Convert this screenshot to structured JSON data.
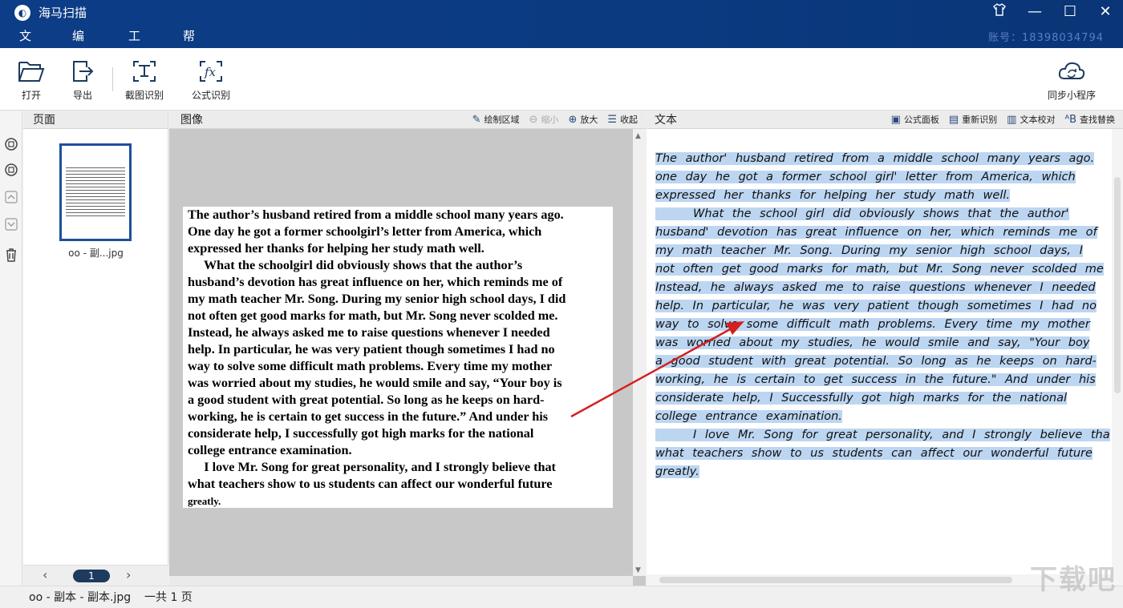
{
  "app": {
    "title": "海马扫描",
    "account": "账号：18398034794"
  },
  "menu": [
    "文件",
    "编辑",
    "工具",
    "帮助"
  ],
  "window": {
    "skin_icon": "shirt-icon",
    "minimize": "—",
    "maximize": "☐",
    "close": "✕"
  },
  "toolbar": {
    "open": "打开",
    "export": "导出",
    "crop_ocr": "截图识别",
    "formula_ocr": "公式识别",
    "sync": "同步小程序"
  },
  "pages": {
    "header": "页面",
    "thumb_name": "oo - 副...jpg",
    "page_number": "1"
  },
  "image": {
    "header": "图像",
    "draw_area": "绘制区域",
    "zoom_out": "缩小",
    "zoom_in": "放大",
    "collapse": "收起",
    "lines": [
      "The author’s husband retired from a middle school many years ago.",
      "One day he got a former schoolgirl’s letter from America, which",
      "expressed her thanks for helping her study math well.",
      "     What the schoolgirl did obviously shows that the author’s",
      "husband’s devotion has great influence on her, which reminds me of",
      "my math teacher Mr. Song. During my senior high school days, I did",
      "not often get good marks for math, but Mr. Song never scolded me.",
      "Instead, he always asked me to raise questions whenever I needed",
      "help. In particular, he was very patient though sometimes I had no",
      "way to solve some difficult math problems. Every time my mother",
      "was worried about my studies, he would smile and say, “Your boy is",
      "a good student with great potential. So long as he keeps on hard-",
      "working, he is certain to get success in the future.” And under his",
      "considerate help, I successfully got high marks for the national",
      "college entrance examination.",
      "     I love Mr. Song for great personality, and I strongly believe that",
      "what teachers show to us students can affect our wonderful future",
      "greatly."
    ]
  },
  "text": {
    "header": "文本",
    "formula_panel": "公式面板",
    "re_recognize": "重新识别",
    "proofread": "文本校对",
    "find_replace": "查找替换",
    "lines": [
      "The author' husband retired from a middle school many years ago.",
      "one day he got a former school girl' letter from America, which",
      "expressed her thanks for helping her study math well.",
      "     What the school girl did obviously shows that the author'",
      "husband' devotion has great influence on her, which reminds me of",
      "my math teacher Mr. Song. During my senior high school days, I",
      "not often get good marks for math, but Mr. Song never scolded me",
      "Instead, he always asked me to raise questions whenever I needed",
      "help. In particular, he was very patient though sometimes I had no",
      "way to solve some difficult math problems. Every time my mother",
      "was worried about my studies, he would smile and say, \"Your boy",
      "a good student with great potential. So long as he keeps on hard-",
      "working, he is certain to get success in the future.\" And under his",
      "considerate help, I Successfully got high marks for the national",
      "college entrance examination.",
      "     I love Mr. Song for great personality, and I strongly believe tha",
      "what teachers show to us students can affect our wonderful future",
      "greatly."
    ]
  },
  "status": {
    "file": "oo - 副本 - 副本.jpg",
    "total": "一共 1 页"
  },
  "watermark": "下载吧",
  "colors": {
    "titlebar": "#0c3d86",
    "selection": "#bcd6f2",
    "arrow": "#d42020"
  }
}
